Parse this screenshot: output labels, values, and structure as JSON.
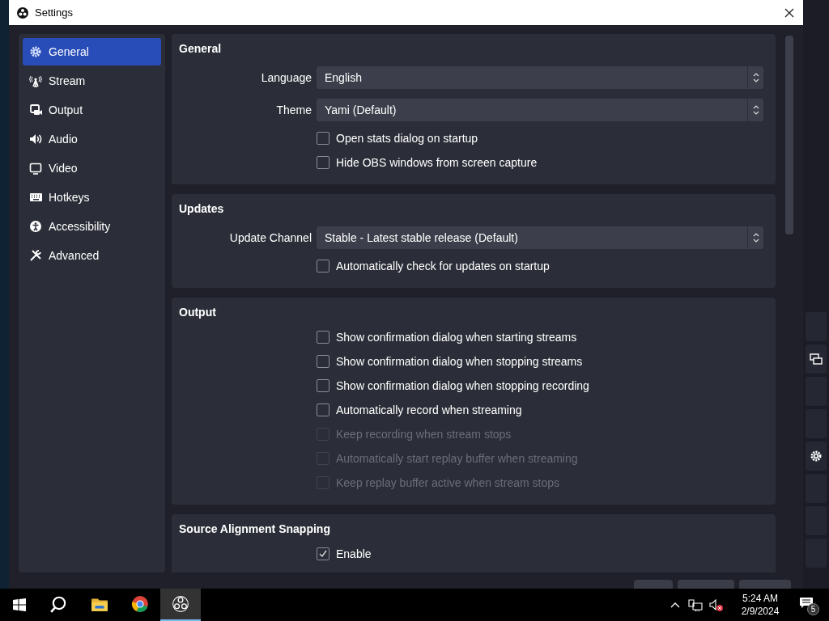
{
  "window": {
    "title": "Settings"
  },
  "sidebar": {
    "items": [
      {
        "label": "General",
        "selected": true
      },
      {
        "label": "Stream",
        "selected": false
      },
      {
        "label": "Output",
        "selected": false
      },
      {
        "label": "Audio",
        "selected": false
      },
      {
        "label": "Video",
        "selected": false
      },
      {
        "label": "Hotkeys",
        "selected": false
      },
      {
        "label": "Accessibility",
        "selected": false
      },
      {
        "label": "Advanced",
        "selected": false
      }
    ]
  },
  "sections": [
    {
      "title": "General",
      "rows": [
        {
          "kind": "select",
          "label": "Language",
          "value": "English"
        },
        {
          "kind": "select",
          "label": "Theme",
          "value": "Yami (Default)"
        },
        {
          "kind": "checkbox",
          "label": "Open stats dialog on startup",
          "checked": false,
          "disabled": false
        },
        {
          "kind": "checkbox",
          "label": "Hide OBS windows from screen capture",
          "checked": false,
          "disabled": false
        }
      ]
    },
    {
      "title": "Updates",
      "rows": [
        {
          "kind": "select",
          "label": "Update Channel",
          "value": "Stable - Latest stable release (Default)"
        },
        {
          "kind": "checkbox",
          "label": "Automatically check for updates on startup",
          "checked": false,
          "disabled": false
        }
      ]
    },
    {
      "title": "Output",
      "rows": [
        {
          "kind": "checkbox",
          "label": "Show confirmation dialog when starting streams",
          "checked": false,
          "disabled": false
        },
        {
          "kind": "checkbox",
          "label": "Show confirmation dialog when stopping streams",
          "checked": false,
          "disabled": false
        },
        {
          "kind": "checkbox",
          "label": "Show confirmation dialog when stopping recording",
          "checked": false,
          "disabled": false
        },
        {
          "kind": "checkbox",
          "label": "Automatically record when streaming",
          "checked": false,
          "disabled": false
        },
        {
          "kind": "checkbox",
          "label": "Keep recording when stream stops",
          "checked": false,
          "disabled": true
        },
        {
          "kind": "checkbox",
          "label": "Automatically start replay buffer when streaming",
          "checked": false,
          "disabled": true
        },
        {
          "kind": "checkbox",
          "label": "Keep replay buffer active when stream stops",
          "checked": false,
          "disabled": true
        }
      ]
    },
    {
      "title": "Source Alignment Snapping",
      "rows": [
        {
          "kind": "checkbox",
          "label": "Enable",
          "checked": true,
          "disabled": false
        }
      ]
    }
  ],
  "taskbar": {
    "apps": [
      {
        "selected": false
      },
      {
        "selected": false
      },
      {
        "selected": false
      },
      {
        "selected": true
      }
    ],
    "time": "5:24 AM",
    "date": "2/9/2024",
    "notification_count": "5"
  }
}
